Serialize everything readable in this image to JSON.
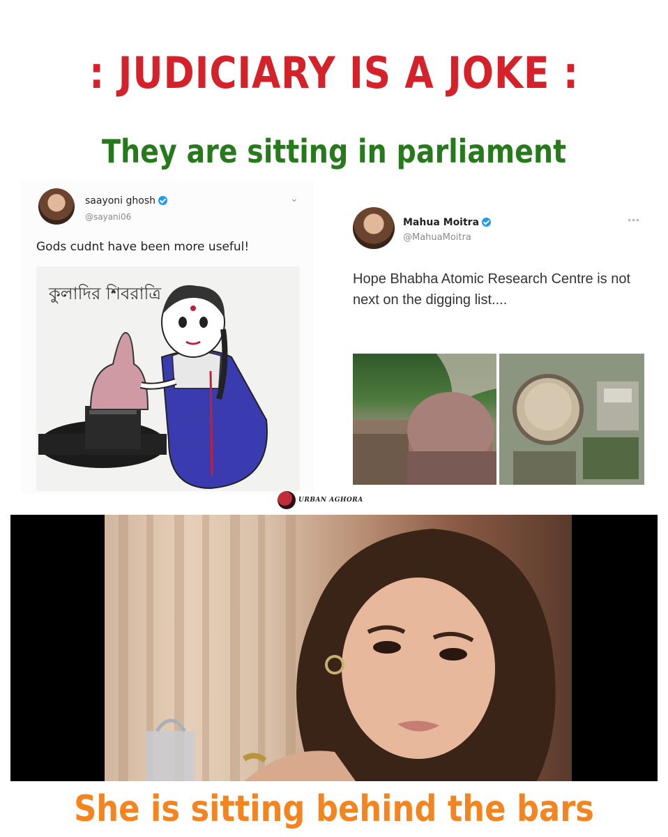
{
  "headline_top": ": JUDICIARY IS A JOKE :",
  "headline_middle": "They are sitting in parliament",
  "headline_bottom": "She is sitting behind the bars",
  "colors": {
    "headline_top": "#d4212a",
    "headline_middle": "#267a1c",
    "headline_bottom": "#f3841f",
    "verified_badge": "#1d9bf0"
  },
  "tweet_left": {
    "username": "saayoni ghosh",
    "handle": "@sayani06",
    "text": "Gods cudnt have been more useful!",
    "image_caption": "কুলাদির শিবরাত্রি"
  },
  "tweet_right": {
    "username": "Mahua Moitra",
    "handle": "@MahuaMoitra",
    "text": "Hope Bhabha Atomic Research Centre is not next on the digging list...."
  },
  "watermark": "URBAN AGHORA",
  "icons": [
    "verified-icon",
    "chevron-down-icon",
    "more-dots-icon",
    "watermark-logo-icon"
  ]
}
